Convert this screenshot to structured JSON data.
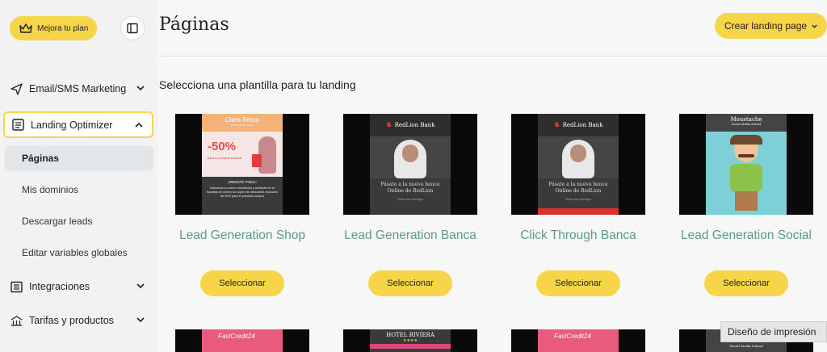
{
  "sidebar": {
    "upgrade_label": "Mejora tu plan",
    "sections": [
      {
        "label": "Email/SMS Marketing",
        "icon": "send-icon"
      },
      {
        "label": "Landing Optimizer",
        "icon": "landing-icon"
      },
      {
        "label": "Integraciones",
        "icon": "list-icon"
      },
      {
        "label": "Tarifas y productos",
        "icon": "scale-icon"
      }
    ],
    "sub_items": [
      {
        "label": "Páginas"
      },
      {
        "label": "Mis dominios"
      },
      {
        "label": "Descargar leads"
      },
      {
        "label": "Editar variables globales"
      }
    ]
  },
  "header": {
    "title": "Páginas",
    "create_label": "Crear landing page"
  },
  "main": {
    "section_title": "Selecciona una plantilla para tu landing",
    "select_label": "Seleccionar",
    "templates": [
      {
        "name": "Lead Generation Shop",
        "thumb": {
          "brand": "Clara Ribau",
          "sub": "HOMEWEAR SHELL",
          "discount": "-50%",
          "discount_note": "para tu próxima compra",
          "banner": "¡REMATE FINAL!",
          "body": "Indícanos tu correo electrónico y recibirás en tu bandeja de correo un cupón de descuento exclusivo de 50% para tu próxima compra"
        }
      },
      {
        "name": "Lead Generation Banca",
        "thumb": {
          "brand": "RedLion Bank",
          "text": "Pásate a la nueva banca Online de RedLion",
          "small": "Todo son ventajas"
        }
      },
      {
        "name": "Click Through Banca",
        "thumb": {
          "brand": "RedLion Bank",
          "text": "Pásate a la nueva banca Online de RedLion",
          "small": "Todo son ventajas"
        }
      },
      {
        "name": "Lead Generation Social",
        "thumb": {
          "brand": "Moustache",
          "sub": "Social Media School"
        }
      }
    ],
    "row2": [
      {
        "brand": "FastCredit24"
      },
      {
        "brand": "HOTEL RIVIERA",
        "stars": "★★★★"
      },
      {
        "brand": "FastCredit24"
      },
      {
        "brand": "Social Media School"
      }
    ]
  },
  "tooltip": {
    "text": "Diseño de impresión"
  },
  "colors": {
    "accent": "#f7d548",
    "card_title": "#5f9a86",
    "sidebar_bg": "#f2f2f2"
  }
}
